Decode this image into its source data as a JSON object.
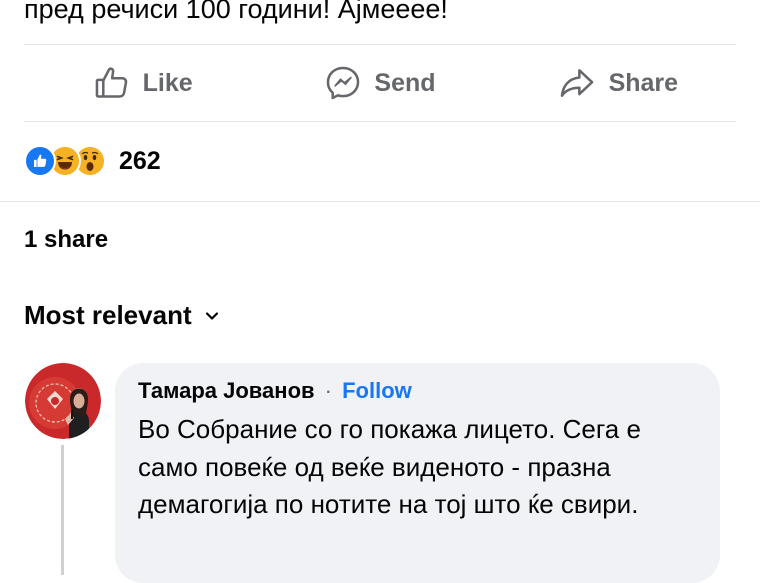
{
  "post": {
    "text": "пред речиси 100 години! Ајмееее!"
  },
  "actions": {
    "like": "Like",
    "send": "Send",
    "share": "Share"
  },
  "reactions": {
    "count": "262",
    "types": [
      "like",
      "haha",
      "wow"
    ]
  },
  "shares": {
    "text": "1 share"
  },
  "sort": {
    "label": "Most relevant"
  },
  "comment": {
    "author": "Тамара Јованов",
    "separator": "·",
    "follow": "Follow",
    "text": "Во Собрание со го покажа лицето. Сега е само повеќе од веќе виденото - празна демагогија по нотите на тој што ќе свири."
  },
  "colors": {
    "accent": "#1877f2",
    "muted": "#65676b",
    "bubble": "#f0f2f5",
    "divider": "#e2e4e8"
  },
  "icons": {
    "like": "thumbs-up-outline-icon",
    "send": "messenger-icon",
    "share": "share-arrow-icon",
    "sort": "chevron-down-icon"
  }
}
